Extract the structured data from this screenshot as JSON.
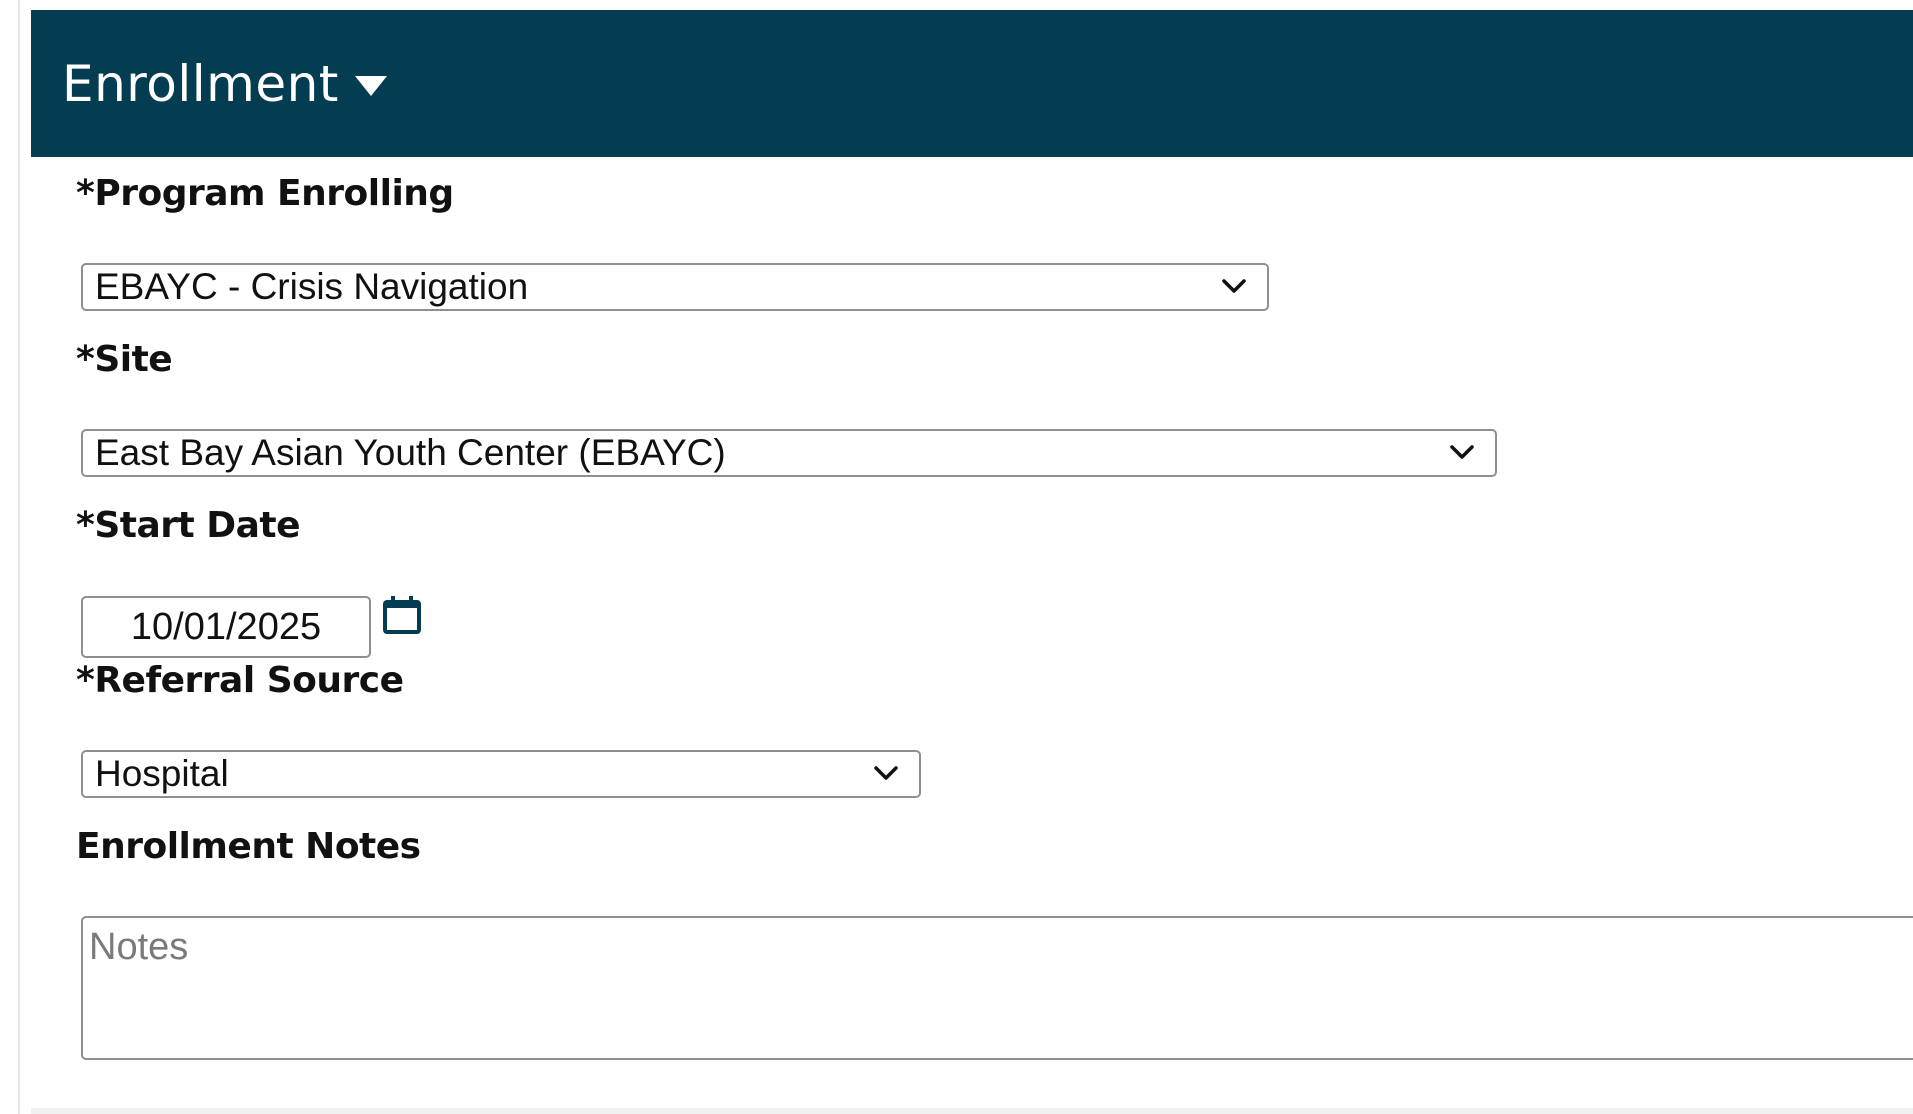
{
  "panel": {
    "title": "Enrollment",
    "header_color": "#043d52",
    "title_dropdown_icon": "caret-down-icon"
  },
  "fields": {
    "program": {
      "label": "*Program Enrolling",
      "value": "EBAYC - Crisis Navigation",
      "icon": "chevron-down-icon"
    },
    "site": {
      "label": "*Site",
      "value": "East Bay Asian Youth Center (EBAYC)",
      "icon": "chevron-down-icon"
    },
    "start_date": {
      "label": "*Start Date",
      "value": "10/01/2025",
      "icon": "calendar-icon"
    },
    "referral_source": {
      "label": "*Referral Source",
      "value": "Hospital",
      "icon": "chevron-down-icon"
    },
    "notes": {
      "label": "Enrollment Notes",
      "placeholder": "Notes",
      "value": ""
    }
  }
}
